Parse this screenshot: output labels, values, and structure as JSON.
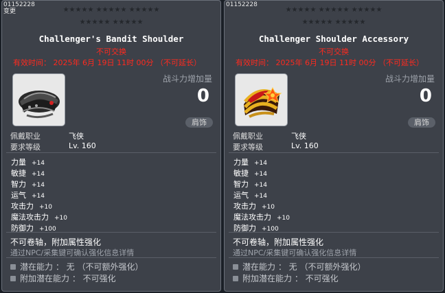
{
  "panels": [
    {
      "item_id": "01152228",
      "item_subtitle": "变更",
      "stars_row1": "★★★★★ ★★★★★ ★★★★★",
      "stars_row2": "★★★★★ ★★★★★",
      "name": "Challenger's Bandit Shoulder",
      "trade_note": "不可交换",
      "expiry": "有效时间： 2025年 6月 19日 11时 00分 （不可延长）",
      "power_label": "战斗力增加量",
      "power_value": "0",
      "category": "肩饰",
      "req_job_label": "佩戴职业",
      "req_job_value": "飞侠",
      "req_level_label": "要求等级",
      "req_level_value": "Lv. 160",
      "stats": [
        {
          "label": "力量",
          "value": "+14"
        },
        {
          "label": "敏捷",
          "value": "+14"
        },
        {
          "label": "智力",
          "value": "+14"
        },
        {
          "label": "运气",
          "value": "+14"
        },
        {
          "label": "攻击力",
          "value": "+10"
        },
        {
          "label": "魔法攻击力",
          "value": "+10"
        },
        {
          "label": "防御力",
          "value": "+100"
        }
      ],
      "upgrade_note": "不可卷轴，附加属性强化",
      "upgrade_hint": "通过NPC/采集键可确认强化信息详情",
      "potential": "潜在能力 ： 无 （不可额外强化）",
      "bonus_potential": "附加潜在能力 ： 不可强化",
      "icon": "dark-bandit-shoulder-icon"
    },
    {
      "item_id": "01152228",
      "item_subtitle": "",
      "stars_row1": "★★★★★ ★★★★★ ★★★★★",
      "stars_row2": "★★★★★ ★★★★★",
      "name": "Challenger Shoulder Accessory",
      "trade_note": "不可交换",
      "expiry": "有效时间： 2025年 6月 19日 11时 00分 （不可延长）",
      "power_label": "战斗力增加量",
      "power_value": "0",
      "category": "肩饰",
      "req_job_label": "佩戴职业",
      "req_job_value": "飞侠",
      "req_level_label": "要求等级",
      "req_level_value": "Lv. 160",
      "stats": [
        {
          "label": "力量",
          "value": "+14"
        },
        {
          "label": "敏捷",
          "value": "+14"
        },
        {
          "label": "智力",
          "value": "+14"
        },
        {
          "label": "运气",
          "value": "+14"
        },
        {
          "label": "攻击力",
          "value": "+10"
        },
        {
          "label": "魔法攻击力",
          "value": "+10"
        },
        {
          "label": "防御力",
          "value": "+100"
        }
      ],
      "upgrade_note": "不可卷轴，附加属性强化",
      "upgrade_hint": "通过NPC/采集键可确认强化信息详情",
      "potential": "潜在能力 ： 无 （不可额外强化）",
      "bonus_potential": "附加潜在能力 ： 不可强化",
      "icon": "gold-red-shoulder-icon"
    }
  ]
}
